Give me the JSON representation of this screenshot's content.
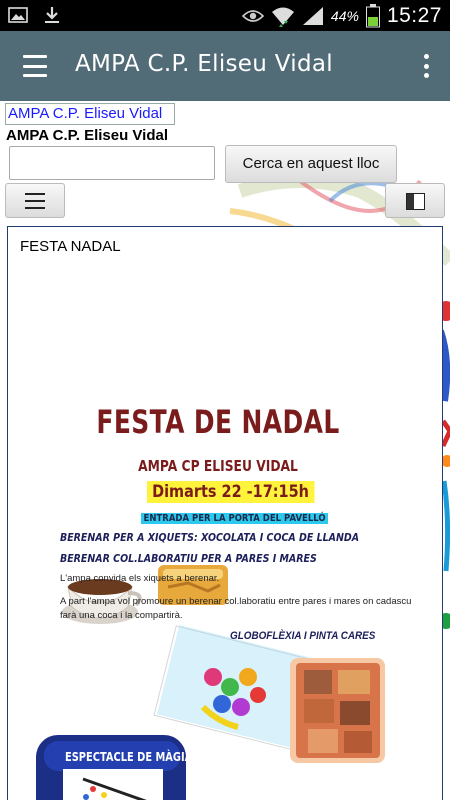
{
  "status_bar": {
    "battery_percent": "44%",
    "time": "15:27",
    "icons": [
      "gallery-icon",
      "download-icon",
      "eye-icon",
      "wifi-icon",
      "signal-icon",
      "battery-icon"
    ]
  },
  "app_bar": {
    "title": "AMPA C.P. Eliseu Vidal",
    "menu_icon": "hamburger-icon",
    "overflow_icon": "more-vert-icon",
    "color": "#516b77"
  },
  "page": {
    "site_link": "AMPA C.P. Eliseu Vidal",
    "site_name": "AMPA C.P. Eliseu Vidal",
    "search": {
      "value": "",
      "placeholder": "",
      "button_label": "Cerca en aquest lloc"
    },
    "nav_toggle_icon": "hamburger-icon",
    "sidebar_toggle_icon": "sidebar-toggle-icon"
  },
  "article": {
    "title": "FESTA NADAL",
    "poster": {
      "headline": "FESTA DE NADAL",
      "organizer": "AMPA CP ELISEU VIDAL",
      "date": "Dimarts 22 -17:15h",
      "entrance": "ENTRADA PER LA PORTA DEL PAVELLÓ",
      "line1": "BERENAR PER A XIQUETS:  XOCOLATA I COCA DE LLANDA",
      "line2": "BERENAR COL.LABORATIU PER A PARES I MARES",
      "text1": "L'ampa convida els xiquets a berenar.",
      "text2": "A part l'ampa vol promoure un berenar col.laboratiu entre pares i mares on cadascu",
      "text3": "farà una coca i la compartirà.",
      "activity": "GLOBOFLÈXIA I PINTA CARES",
      "show": "ESPECTACLE DE MÀGIA"
    },
    "colors": {
      "headline": "#7a1c1c",
      "date_highlight": "#fff33b",
      "entrance_highlight": "#2cc8ee",
      "border": "#1f3c73"
    }
  }
}
